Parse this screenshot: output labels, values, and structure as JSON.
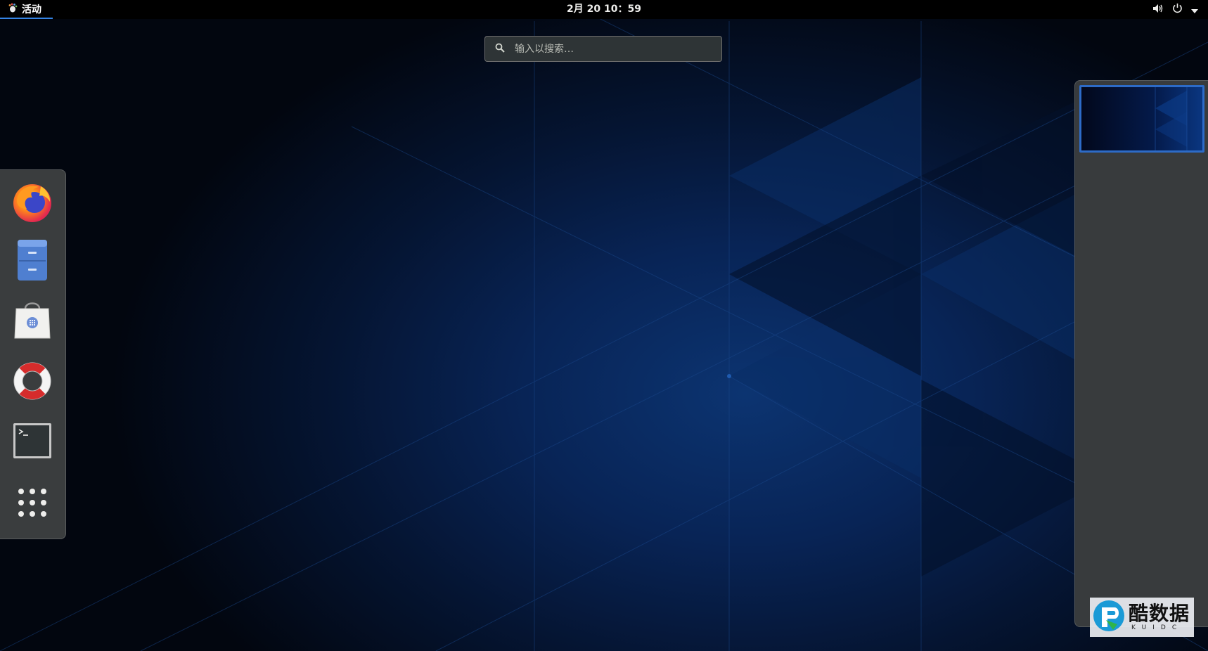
{
  "topbar": {
    "activities_label": "活动",
    "clock": "2月 20  10：59",
    "icons": [
      "volume-icon",
      "power-icon",
      "dropdown-arrow-icon"
    ]
  },
  "search": {
    "placeholder": "输入以搜索…"
  },
  "dash": {
    "items": [
      {
        "name": "Firefox",
        "icon": "firefox-icon"
      },
      {
        "name": "Files",
        "icon": "file-cabinet-icon"
      },
      {
        "name": "Software",
        "icon": "shopping-bag-icon"
      },
      {
        "name": "Help",
        "icon": "lifebuoy-icon"
      },
      {
        "name": "Terminal",
        "icon": "terminal-icon"
      },
      {
        "name": "Show Applications",
        "icon": "app-grid-icon"
      }
    ]
  },
  "workspaces": {
    "count": 1,
    "active_index": 0
  },
  "watermark": {
    "main": "酷数据",
    "sub": "KUIDC"
  },
  "colors": {
    "accent": "#3584e4",
    "topbar": "#000000",
    "dash_bg": "#3a3d3e",
    "wallpaper_blue": "#0c3471"
  }
}
